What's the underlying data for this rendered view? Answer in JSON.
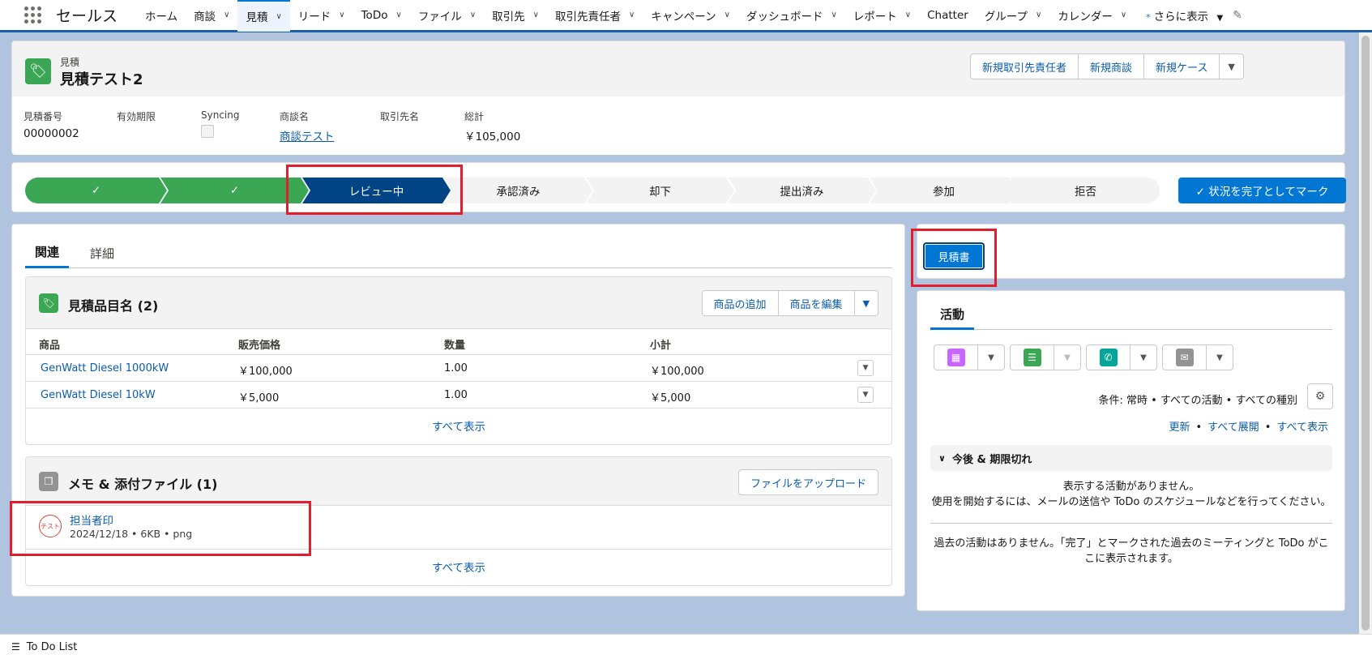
{
  "nav": {
    "app_name": "セールス",
    "items": [
      {
        "label": "ホーム",
        "has_menu": false
      },
      {
        "label": "商談",
        "has_menu": true
      },
      {
        "label": "見積",
        "has_menu": true,
        "active": true
      },
      {
        "label": "リード",
        "has_menu": true
      },
      {
        "label": "ToDo",
        "has_menu": true
      },
      {
        "label": "ファイル",
        "has_menu": true
      },
      {
        "label": "取引先",
        "has_menu": true
      },
      {
        "label": "取引先責任者",
        "has_menu": true
      },
      {
        "label": "キャンペーン",
        "has_menu": true
      },
      {
        "label": "ダッシュボード",
        "has_menu": true
      },
      {
        "label": "レポート",
        "has_menu": true
      },
      {
        "label": "Chatter",
        "has_menu": false
      },
      {
        "label": "グループ",
        "has_menu": true
      },
      {
        "label": "カレンダー",
        "has_menu": true
      }
    ],
    "more": "さらに表示",
    "more_marker": "*"
  },
  "record": {
    "object_type": "見積",
    "title": "見積テスト2",
    "actions": [
      "新規取引先責任者",
      "新規商談",
      "新規ケース"
    ],
    "fields": [
      {
        "label": "見積番号",
        "value": "00000002"
      },
      {
        "label": "有効期限",
        "value": ""
      },
      {
        "label": "Syncing",
        "value": ""
      },
      {
        "label": "商談名",
        "value": "商談テスト"
      },
      {
        "label": "取引先名",
        "value": ""
      },
      {
        "label": "総計",
        "value": "￥105,000"
      }
    ]
  },
  "path": {
    "stages": [
      {
        "label": "✓",
        "status": "done"
      },
      {
        "label": "✓",
        "status": "done"
      },
      {
        "label": "レビュー中",
        "status": "current"
      },
      {
        "label": "承認済み",
        "status": "todo"
      },
      {
        "label": "却下",
        "status": "todo"
      },
      {
        "label": "提出済み",
        "status": "todo"
      },
      {
        "label": "参加",
        "status": "todo"
      },
      {
        "label": "拒否",
        "status": "todo"
      }
    ],
    "mark_complete": "✓ 状況を完了としてマーク"
  },
  "tabs": [
    "関連",
    "詳細"
  ],
  "line_items": {
    "title": "見積品目名 (2)",
    "buttons": [
      "商品の追加",
      "商品を編集"
    ],
    "columns": [
      "商品",
      "販売価格",
      "数量",
      "小計"
    ],
    "rows": [
      [
        "GenWatt Diesel 1000kW",
        "￥100,000",
        "1.00",
        "￥100,000"
      ],
      [
        "GenWatt Diesel 10kW",
        "￥5,000",
        "1.00",
        "￥5,000"
      ]
    ],
    "view_all": "すべて表示"
  },
  "notes": {
    "title": "メモ & 添付ファイル (1)",
    "upload": "ファイルをアップロード",
    "file_name": "担当者印",
    "file_meta": "2024/12/18 • 6KB • png",
    "stamp_text": "テスト",
    "view_all": "すべて表示"
  },
  "quote_button": "見積書",
  "activity": {
    "tab": "活動",
    "filters": "条件: 常時 • すべての活動 • すべての種別",
    "links": [
      "更新",
      "すべて展開",
      "すべて表示"
    ],
    "upcoming": "今後 & 期限切れ",
    "no_activity_line1": "表示する活動がありません。",
    "no_activity_line2": "使用を開始するには、メールの送信や ToDo のスケジュールなどを行ってください。",
    "past_line1": "過去の活動はありません。「完了」とマークされた過去のミーティングと ToDo がこ",
    "past_line2": "こに表示されます。"
  },
  "utility": {
    "label": "To Do List"
  },
  "colors": {
    "brand": "#0176d3",
    "done": "#3ba755",
    "current": "#014486",
    "highlight": "#e21e2d"
  }
}
